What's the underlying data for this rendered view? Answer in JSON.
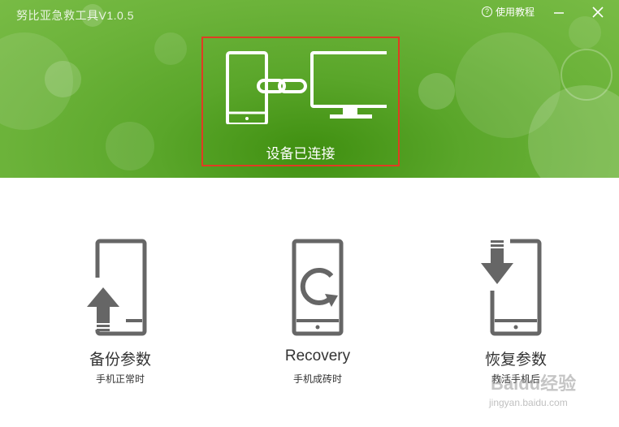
{
  "window": {
    "title": "努比亚急救工具V1.0.5",
    "help_label": "使用教程"
  },
  "header": {
    "status_text": "设备已连接",
    "accent_color": "#6cb33a",
    "highlight_color": "#e03c23"
  },
  "actions": [
    {
      "title": "备份参数",
      "subtitle": "手机正常时",
      "icon": "phone-backup-upload-icon"
    },
    {
      "title": "Recovery",
      "subtitle": "手机成砖时",
      "icon": "phone-recovery-refresh-icon"
    },
    {
      "title": "恢复参数",
      "subtitle": "救活手机后",
      "icon": "phone-restore-download-icon"
    }
  ],
  "watermark": {
    "line1": "Baidu经验",
    "line2": "jingyan.baidu.com"
  }
}
